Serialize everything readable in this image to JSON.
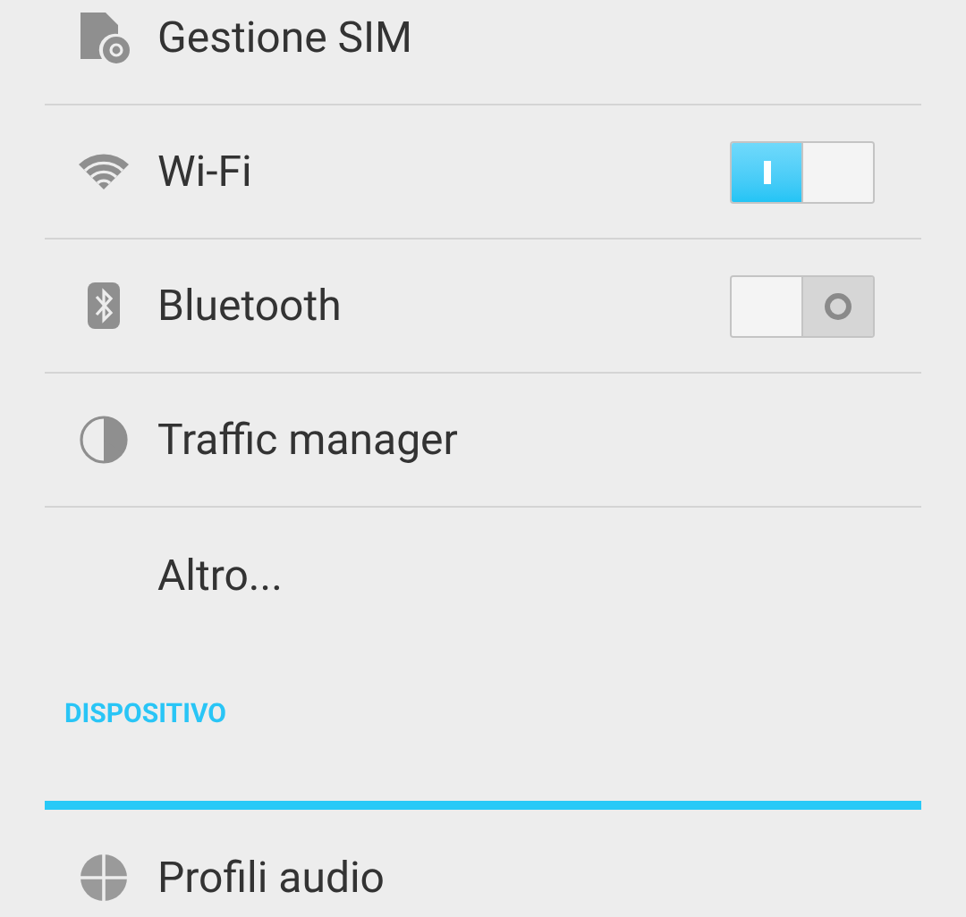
{
  "items": [
    {
      "label": "Gestione SIM",
      "kind": "plain"
    },
    {
      "label": "Wi-Fi",
      "kind": "toggle",
      "on": true
    },
    {
      "label": "Bluetooth",
      "kind": "toggle",
      "on": false
    },
    {
      "label": "Traffic manager",
      "kind": "plain"
    },
    {
      "label": "Altro...",
      "kind": "plain"
    }
  ],
  "section": {
    "title": "DISPOSITIVO"
  },
  "device_items": [
    {
      "label": "Profili audio"
    }
  ]
}
